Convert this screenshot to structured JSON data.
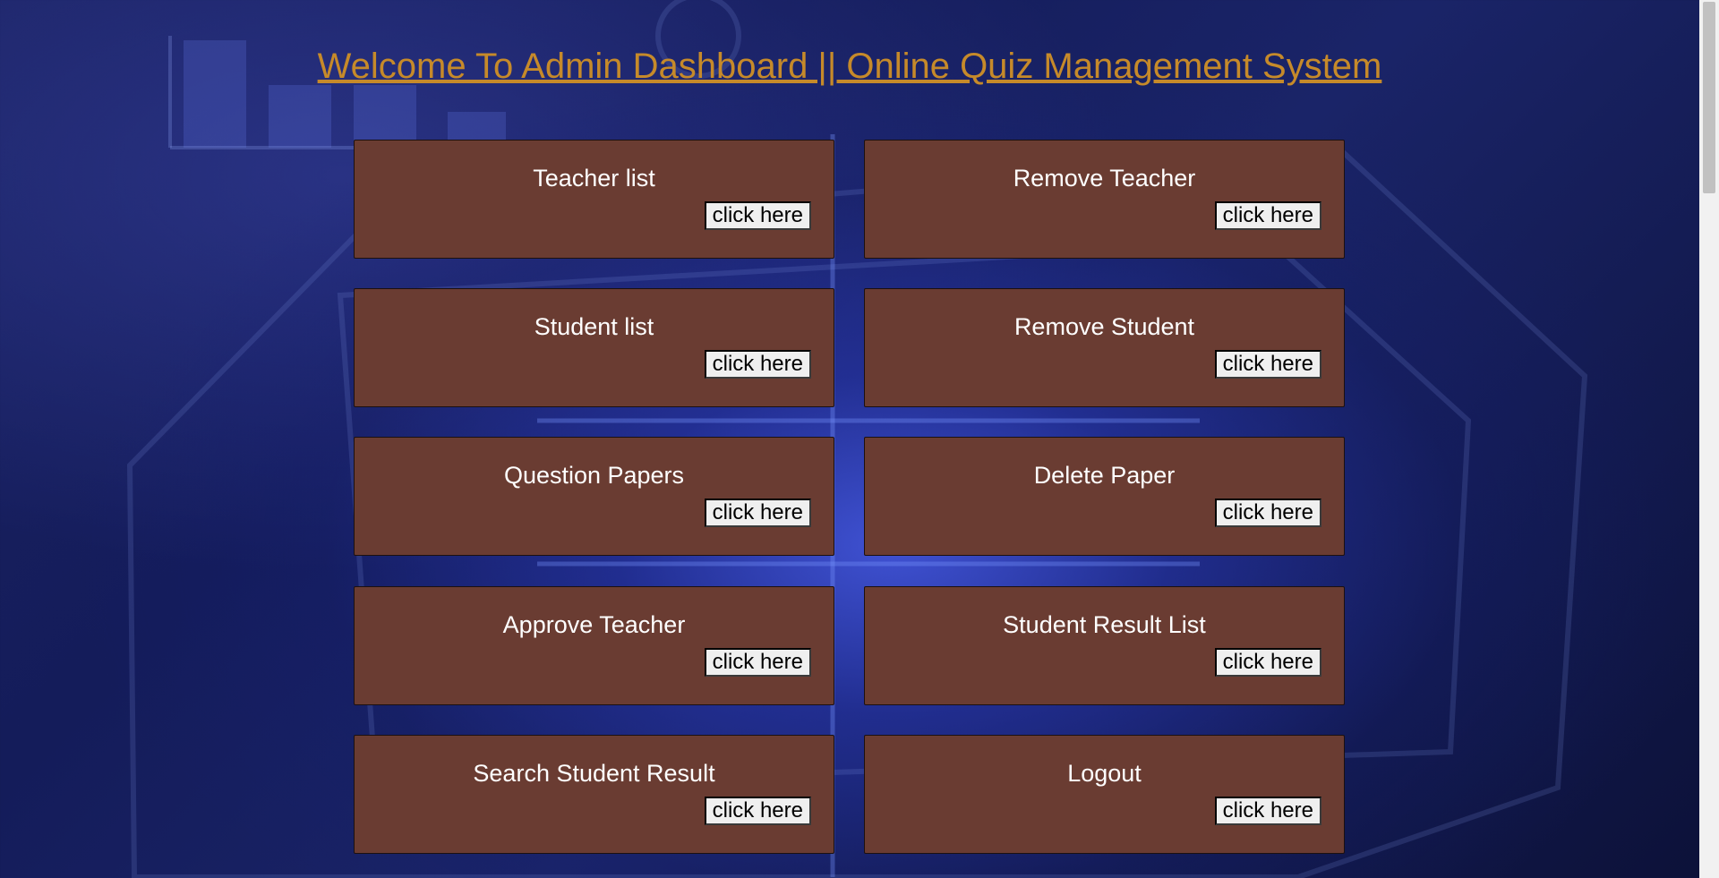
{
  "page": {
    "title": "Welcome To Admin Dashboard || Online Quiz Management System"
  },
  "cards": [
    {
      "title": "Teacher list",
      "button": "click here"
    },
    {
      "title": "Remove Teacher",
      "button": "click here"
    },
    {
      "title": "Student list",
      "button": "click here"
    },
    {
      "title": "Remove Student",
      "button": "click here"
    },
    {
      "title": "Question Papers",
      "button": "click here"
    },
    {
      "title": "Delete Paper",
      "button": "click here"
    },
    {
      "title": "Approve Teacher",
      "button": "click here"
    },
    {
      "title": "Student Result List",
      "button": "click here"
    },
    {
      "title": "Search Student Result",
      "button": "click here"
    },
    {
      "title": "Logout",
      "button": "click here"
    }
  ],
  "colors": {
    "title": "#c68a2a",
    "card_background": "#6a3c32",
    "card_text": "#ffffff",
    "page_background": "#141c5a"
  }
}
